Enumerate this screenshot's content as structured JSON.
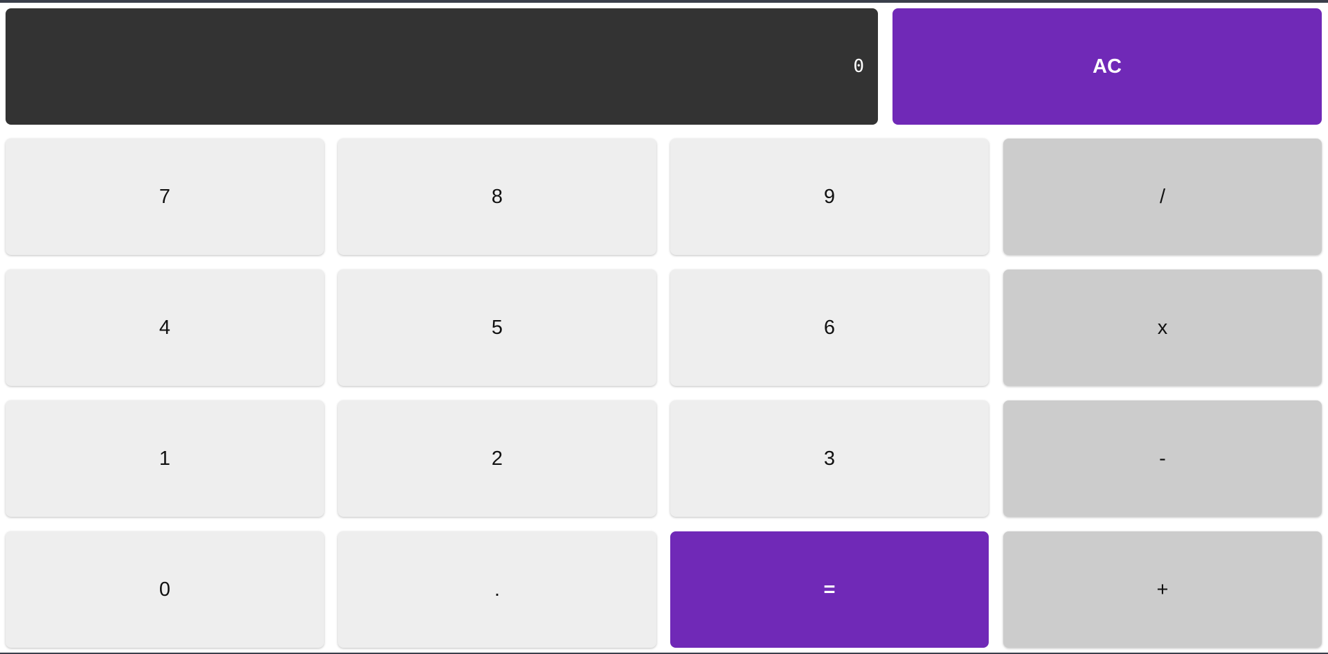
{
  "display": {
    "value": "0"
  },
  "buttons": {
    "clear": "AC",
    "seven": "7",
    "eight": "8",
    "nine": "9",
    "divide": "/",
    "four": "4",
    "five": "5",
    "six": "6",
    "multiply": "x",
    "one": "1",
    "two": "2",
    "three": "3",
    "subtract": "-",
    "zero": "0",
    "decimal": ".",
    "equals": "=",
    "add": "+"
  },
  "colors": {
    "accent": "#7029b7",
    "display_bg": "#333333",
    "number_key": "#eeeeee",
    "operator_key": "#cccccc"
  }
}
